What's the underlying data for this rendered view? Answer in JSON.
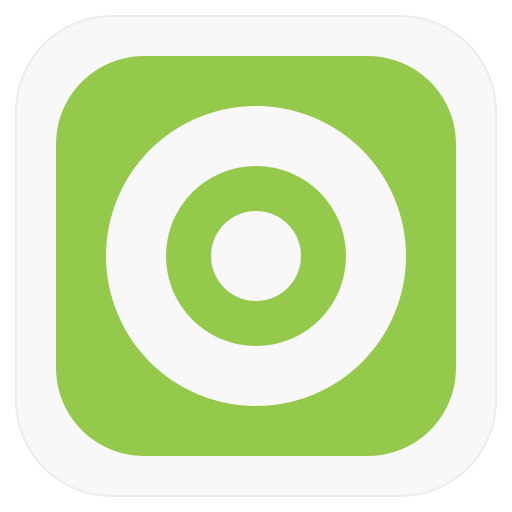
{
  "icon": {
    "name": "target-icon",
    "colors": {
      "background": "#ffffff",
      "plate": "#f8f8f8",
      "plate_border": "#ececec",
      "tile": "#95c94b",
      "ring_light": "#f8f8f8"
    }
  }
}
